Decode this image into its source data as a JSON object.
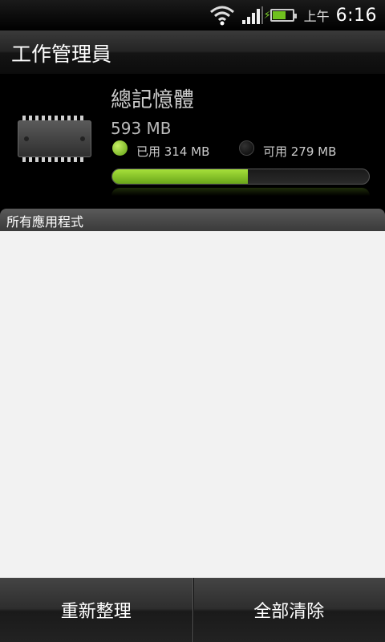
{
  "status_bar": {
    "ampm": "上午",
    "time": "6:16",
    "battery_level": 0.7,
    "icons": [
      "wifi-icon",
      "signal-icon",
      "battery-charging-icon"
    ]
  },
  "header": {
    "title": "工作管理員"
  },
  "memory": {
    "title": "總記憶體",
    "total": "593 MB",
    "used_label": "已用 314 MB",
    "free_label": "可用 279 MB",
    "used_fraction": 0.529,
    "colors": {
      "used": "#8fd12b",
      "track": "#1a1a1a"
    }
  },
  "section": {
    "label": "所有應用程式"
  },
  "actions": {
    "refresh_label": "重新整理",
    "clear_all_label": "全部清除"
  }
}
